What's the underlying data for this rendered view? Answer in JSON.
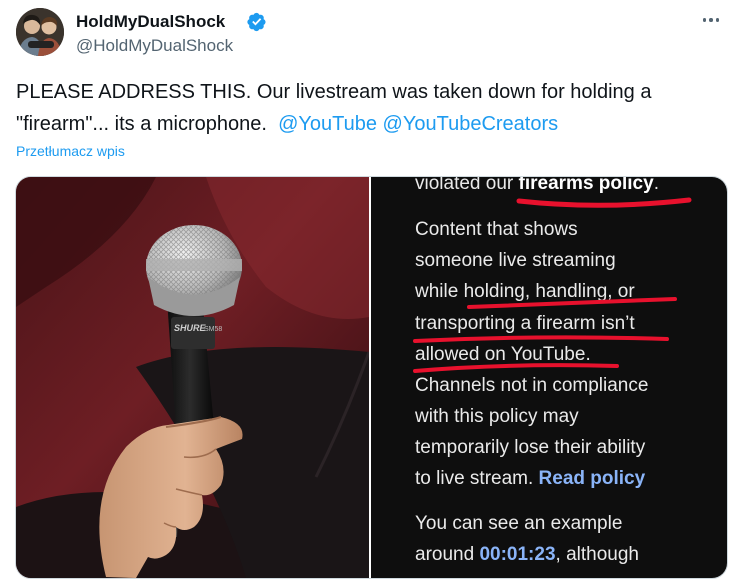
{
  "tweet": {
    "display_name": "HoldMyDualShock",
    "handle": "@HoldMyDualShock",
    "text_line1": "PLEASE ADDRESS THIS. Our livestream was taken down for holding a",
    "text_line2_prefix": "\"firearm\"... its a microphone.",
    "mention_1": "@YouTube",
    "mention_2": "@YouTubeCreators",
    "translate_label": "Przetłumacz wpis",
    "verified_icon": "verified-badge-icon",
    "more_icon": "more-options-icon",
    "accent_color": "#1d9bf0"
  },
  "screenshot": {
    "line_1_prefix": "violated our ",
    "line_1_bold": "firearms policy",
    "line_1_suffix": ".",
    "line_2": "Content that shows",
    "line_3": "someone live streaming",
    "line_4": "while holding, handling, or",
    "line_5": "transporting a firearm isn’t",
    "line_6": "allowed on YouTube.",
    "line_7": "Channels not in compliance",
    "line_8": "with this policy may",
    "line_9": "temporarily lose their ability",
    "line_10_prefix": "to live stream. ",
    "line_10_link": "Read policy",
    "line_11": "You can see an example",
    "line_12_prefix": "around ",
    "line_12_time": "00:01:23",
    "line_12_suffix": ", although",
    "underline_color": "#e8112d"
  },
  "photo": {
    "mic_brand": "SHURE",
    "mic_model": "SM58"
  }
}
